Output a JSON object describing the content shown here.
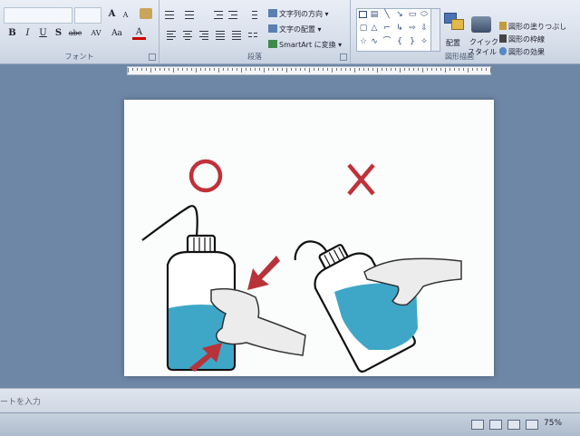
{
  "ribbon": {
    "font_group": {
      "label": "フォント",
      "grow_font": "A",
      "shrink_font": "A",
      "bold": "B",
      "italic": "I",
      "underline": "U",
      "strike": "S",
      "abc": "abc",
      "spacing": "AV",
      "case": "Aa",
      "font_color": "A"
    },
    "paragraph_group": {
      "label": "段落",
      "text_direction": "文字列の方向",
      "align_text": "文字の配置",
      "smartart": "SmartArt に変換"
    },
    "drawing_group": {
      "label": "図形描画",
      "arrange": "配置",
      "quick_styles_1": "クイック",
      "quick_styles_2": "スタイル",
      "shape_fill": "図形の塗りつぶし",
      "shape_outline": "図形の枠線",
      "shape_effects": "図形の効果"
    }
  },
  "slide": {
    "correct_mark": "O",
    "wrong_mark": "X"
  },
  "notes": {
    "placeholder": "ートを入力"
  },
  "status": {
    "zoom": "75%"
  },
  "colors": {
    "mark_red": "#c0313a",
    "liquid": "#3ea7c8",
    "arrow": "#b8323a"
  }
}
